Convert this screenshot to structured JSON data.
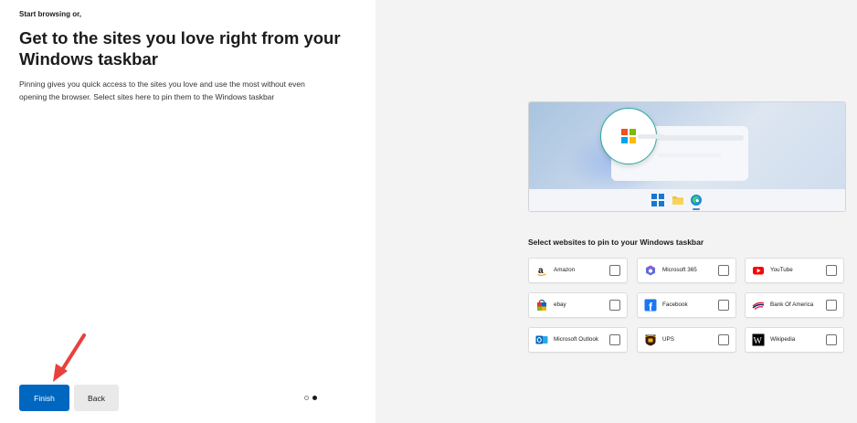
{
  "left": {
    "kicker": "Start browsing or,",
    "title": "Get to the sites you love right from your Windows taskbar",
    "description": "Pinning gives you quick access to the sites you love and use the most without even opening the browser. Select sites here to pin them to the Windows taskbar"
  },
  "buttons": {
    "finish": "Finish",
    "back": "Back"
  },
  "pagination": {
    "current": 2,
    "total": 2
  },
  "right": {
    "pin_title": "Select websites to pin to your Windows taskbar",
    "sites": [
      {
        "label": "Amazon",
        "icon": "amazon-icon",
        "checked": false
      },
      {
        "label": "Microsoft 365",
        "icon": "microsoft-365-icon",
        "checked": false
      },
      {
        "label": "YouTube",
        "icon": "youtube-icon",
        "checked": false
      },
      {
        "label": "ebay",
        "icon": "ebay-icon",
        "checked": false
      },
      {
        "label": "Facebook",
        "icon": "facebook-icon",
        "checked": false
      },
      {
        "label": "Bank Of America",
        "icon": "bank-of-america-icon",
        "checked": false
      },
      {
        "label": "Microsoft Outlook",
        "icon": "outlook-icon",
        "checked": false
      },
      {
        "label": "UPS",
        "icon": "ups-icon",
        "checked": false
      },
      {
        "label": "Wikipedia",
        "icon": "wikipedia-icon",
        "checked": false
      }
    ]
  },
  "colors": {
    "accent": "#0067c0",
    "annotation_arrow": "#e8413c",
    "right_pane_bg": "#f3f3f3"
  }
}
